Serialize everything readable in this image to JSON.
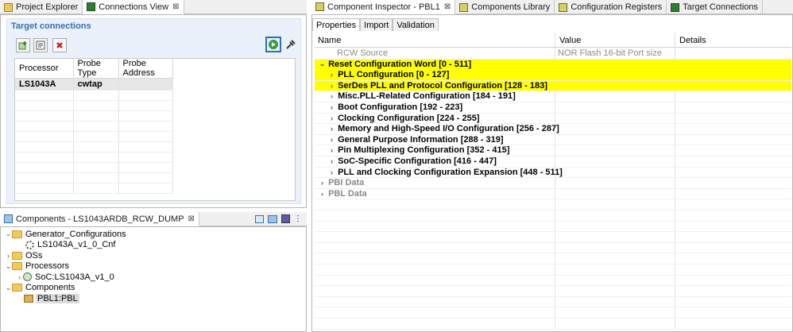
{
  "left_tabs": [
    {
      "label": "Project Explorer",
      "icon": "project-explorer-icon"
    },
    {
      "label": "Connections View",
      "icon": "connections-view-icon",
      "close": "⊠"
    }
  ],
  "connections": {
    "title": "Target connections",
    "columns": [
      "Processor",
      "Probe Type",
      "Probe Address"
    ],
    "rows": [
      [
        "LS1043A",
        "cwtap",
        ""
      ]
    ]
  },
  "components_tab": {
    "label": "Components - LS1043ARDB_RCW_DUMP",
    "close": "⊠"
  },
  "tree": [
    {
      "label": "Generator_Configurations"
    },
    {
      "label": "LS1043A_v1_0_Cnf"
    },
    {
      "label": "OSs"
    },
    {
      "label": "Processors"
    },
    {
      "label": "SoC:LS1043A_v1_0"
    },
    {
      "label": "Components"
    },
    {
      "label": "PBL1:PBL"
    }
  ],
  "right_tabs": [
    {
      "label": "Component Inspector - PBL1",
      "close": "⊠"
    },
    {
      "label": "Components Library"
    },
    {
      "label": "Configuration Registers"
    },
    {
      "label": "Target Connections"
    }
  ],
  "subtabs": [
    "Properties",
    "Import",
    "Validation"
  ],
  "grid": {
    "columns": [
      "Name",
      "Value",
      "Details"
    ],
    "rows": [
      {
        "name": "RCW Source",
        "value": "NOR Flash 16-bit Port size"
      },
      {
        "name": "Reset Configuration Word [0 - 511]"
      },
      {
        "name": "PLL Configuration [0 - 127]"
      },
      {
        "name": "SerDes PLL and Protocol Configuration [128 - 183]"
      },
      {
        "name": "Misc.PLL-Related Configuration [184 - 191]"
      },
      {
        "name": "Boot Configuration [192 - 223]"
      },
      {
        "name": "Clocking Configuration [224 - 255]"
      },
      {
        "name": "Memory and High-Speed I/O Configuration [256 - 287]"
      },
      {
        "name": "General Purpose Information [288 - 319]"
      },
      {
        "name": "Pin Multiplexing Configuration [352 - 415]"
      },
      {
        "name": "SoC-Specific Configuration [416 - 447]"
      },
      {
        "name": "PLL and Clocking Configuration Expansion [448 - 511]"
      },
      {
        "name": "PBI Data"
      },
      {
        "name": "PBL Data"
      }
    ]
  },
  "colors": {
    "highlight": "#ffff00",
    "section_bg": "#eaf1fb",
    "section_title": "#3a6ea5"
  }
}
